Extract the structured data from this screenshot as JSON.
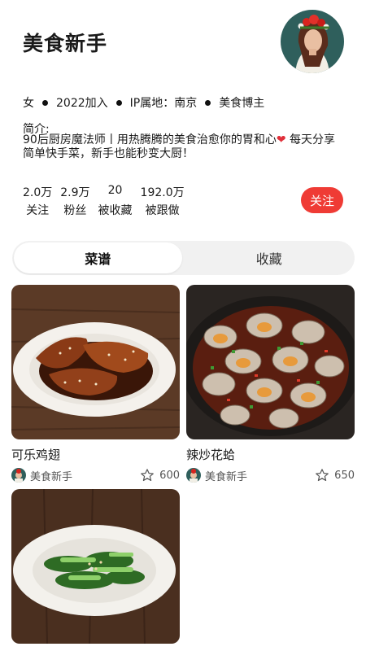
{
  "profile": {
    "name": "美食新手",
    "gender": "女",
    "joined": "2022加入",
    "ip": "IP属地：南京",
    "role": "美食博主",
    "bio_label": "简介:",
    "bio_line1": "90后厨房魔法师丨用热腾腾的美食治愈你的胃和心",
    "bio_heart": "❤",
    "bio_line2": " 每天分享简单快手菜，新手也能秒变大厨！"
  },
  "stats": [
    {
      "value": "2.0万",
      "label": "关注"
    },
    {
      "value": "2.9万",
      "label": "粉丝"
    },
    {
      "value": "20",
      "label": "被收藏"
    },
    {
      "value": "192.0万",
      "label": "被跟做"
    }
  ],
  "follow_label": "关注",
  "tabs": [
    {
      "label": "菜谱",
      "active": true
    },
    {
      "label": "收藏",
      "active": false
    }
  ],
  "recipes": [
    {
      "title": "可乐鸡翅",
      "author": "美食新手",
      "count": "600"
    },
    {
      "title": "辣炒花蛤",
      "author": "美食新手",
      "count": "650"
    },
    {
      "title": "",
      "author": "",
      "count": ""
    }
  ],
  "colors": {
    "accent": "#ef3b35",
    "tab_bg": "#f1f1f1"
  }
}
